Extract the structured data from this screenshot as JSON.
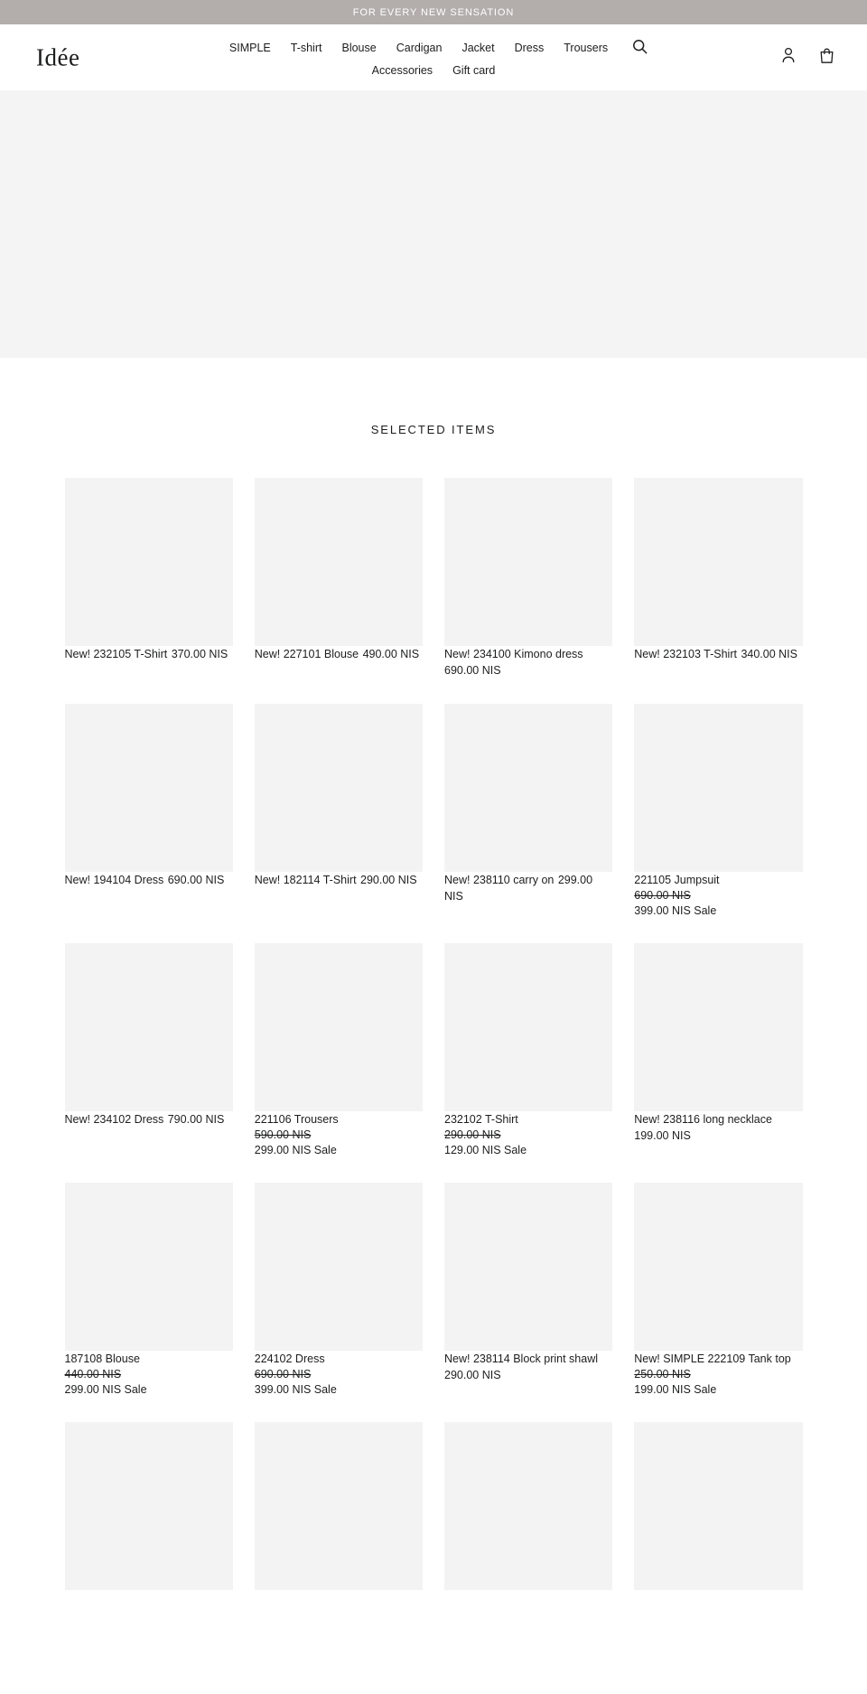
{
  "announcement": {
    "text": "FOR EVERY NEW SENSATION",
    "background": "#b3adab",
    "color": "#ffffff"
  },
  "header": {
    "logo": "Idée",
    "nav": [
      {
        "label": "SIMPLE"
      },
      {
        "label": "T-shirt"
      },
      {
        "label": "Blouse"
      },
      {
        "label": "Cardigan"
      },
      {
        "label": "Jacket"
      },
      {
        "label": "Dress"
      },
      {
        "label": "Trousers"
      },
      {
        "label": "Accessories"
      },
      {
        "label": "Gift card"
      }
    ],
    "search_icon": "search-icon",
    "account_icon": "account-icon",
    "cart_icon": "cart-icon"
  },
  "hero": {
    "background": "#f4f4f4"
  },
  "section": {
    "title": "SELECTED ITEMS"
  },
  "products": [
    {
      "title": "New! 232105 T-Shirt",
      "price": "370.00 NIS",
      "compare_at": null,
      "sale_price": null
    },
    {
      "title": "New! 227101 Blouse",
      "price": "490.00 NIS",
      "compare_at": null,
      "sale_price": null
    },
    {
      "title": "New! 234100 Kimono dress",
      "price": "690.00 NIS",
      "compare_at": null,
      "sale_price": null
    },
    {
      "title": "New! 232103 T-Shirt",
      "price": "340.00 NIS",
      "compare_at": null,
      "sale_price": null
    },
    {
      "title": "New! 194104 Dress",
      "price": "690.00 NIS",
      "compare_at": null,
      "sale_price": null
    },
    {
      "title": "New! 182114 T-Shirt",
      "price": "290.00 NIS",
      "compare_at": null,
      "sale_price": null
    },
    {
      "title": "New! 238110 carry on",
      "price": "299.00 NIS",
      "compare_at": null,
      "sale_price": null
    },
    {
      "title": "221105 Jumpsuit",
      "price": null,
      "compare_at": "690.00 NIS",
      "sale_price": "399.00 NIS Sale"
    },
    {
      "title": "New! 234102 Dress",
      "price": "790.00 NIS",
      "compare_at": null,
      "sale_price": null
    },
    {
      "title": "221106 Trousers",
      "price": null,
      "compare_at": "590.00 NIS",
      "sale_price": "299.00 NIS Sale"
    },
    {
      "title": "232102 T-Shirt",
      "price": null,
      "compare_at": "290.00 NIS",
      "sale_price": "129.00 NIS Sale"
    },
    {
      "title": "New! 238116 long necklace",
      "price": "199.00 NIS",
      "compare_at": null,
      "sale_price": null
    },
    {
      "title": "187108 Blouse",
      "price": null,
      "compare_at": "440.00 NIS",
      "sale_price": "299.00 NIS Sale"
    },
    {
      "title": "224102 Dress",
      "price": null,
      "compare_at": "690.00 NIS",
      "sale_price": "399.00 NIS Sale"
    },
    {
      "title": "New! 238114 Block print shawl",
      "price": "290.00 NIS",
      "compare_at": null,
      "sale_price": null
    },
    {
      "title": "New! SIMPLE 222109 Tank top",
      "price": null,
      "compare_at": "250.00 NIS",
      "sale_price": "199.00 NIS Sale"
    },
    {
      "title": null,
      "price": null,
      "compare_at": null,
      "sale_price": null
    },
    {
      "title": null,
      "price": null,
      "compare_at": null,
      "sale_price": null
    },
    {
      "title": null,
      "price": null,
      "compare_at": null,
      "sale_price": null
    },
    {
      "title": null,
      "price": null,
      "compare_at": null,
      "sale_price": null
    }
  ]
}
